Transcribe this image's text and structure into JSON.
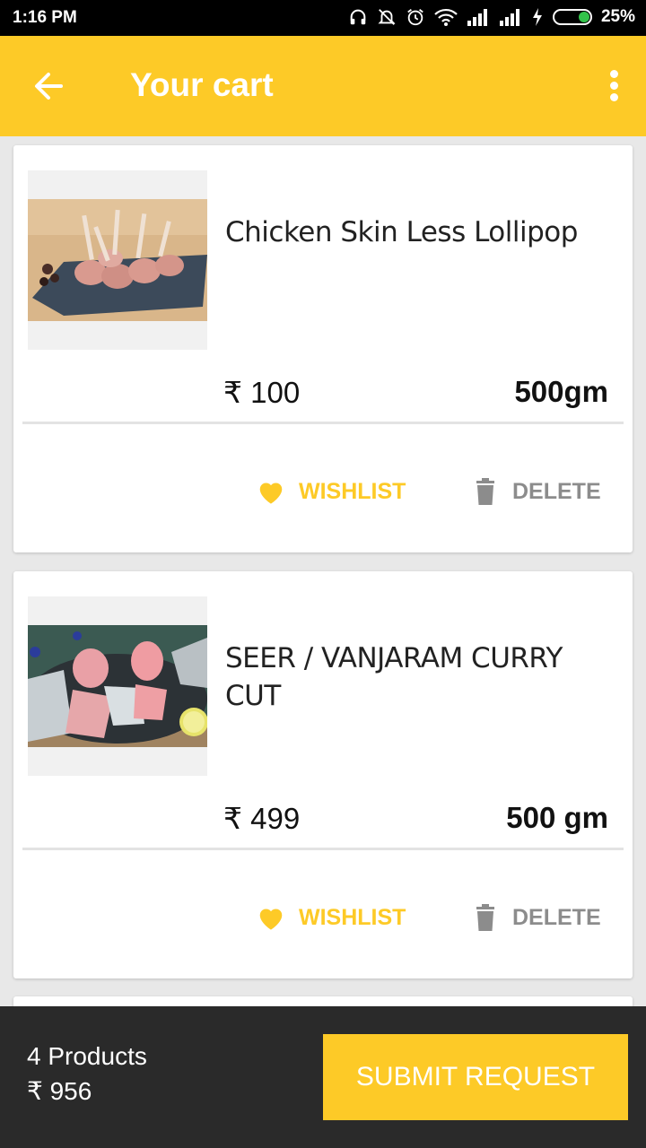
{
  "status_bar": {
    "time": "1:16 PM",
    "battery_percent": "25%",
    "icons": [
      "headphones-icon",
      "bell-off-icon",
      "alarm-icon",
      "wifi-icon",
      "signal-icon",
      "signal-icon",
      "charging-icon",
      "battery-icon"
    ]
  },
  "app_bar": {
    "title": "Your cart",
    "back_icon": "arrow-left-icon",
    "menu_icon": "more-vertical-icon",
    "background": "#fdca27"
  },
  "cart": {
    "items": [
      {
        "name": "Chicken Skin Less Lollipop",
        "price": "₹ 100",
        "weight": "500gm",
        "wishlist_label": "WISHLIST",
        "delete_label": "DELETE"
      },
      {
        "name": "SEER / VANJARAM CURRY CUT",
        "price": "₹ 499",
        "weight": "500 gm",
        "wishlist_label": "WISHLIST",
        "delete_label": "DELETE"
      }
    ]
  },
  "bottom_bar": {
    "product_count": "4 Products",
    "total": "₹ 956",
    "submit_label": "SUBMIT REQUEST"
  },
  "colors": {
    "accent": "#fdca27",
    "bottom_bar": "#2a2a2a",
    "delete_gray": "#8c8c8c"
  }
}
